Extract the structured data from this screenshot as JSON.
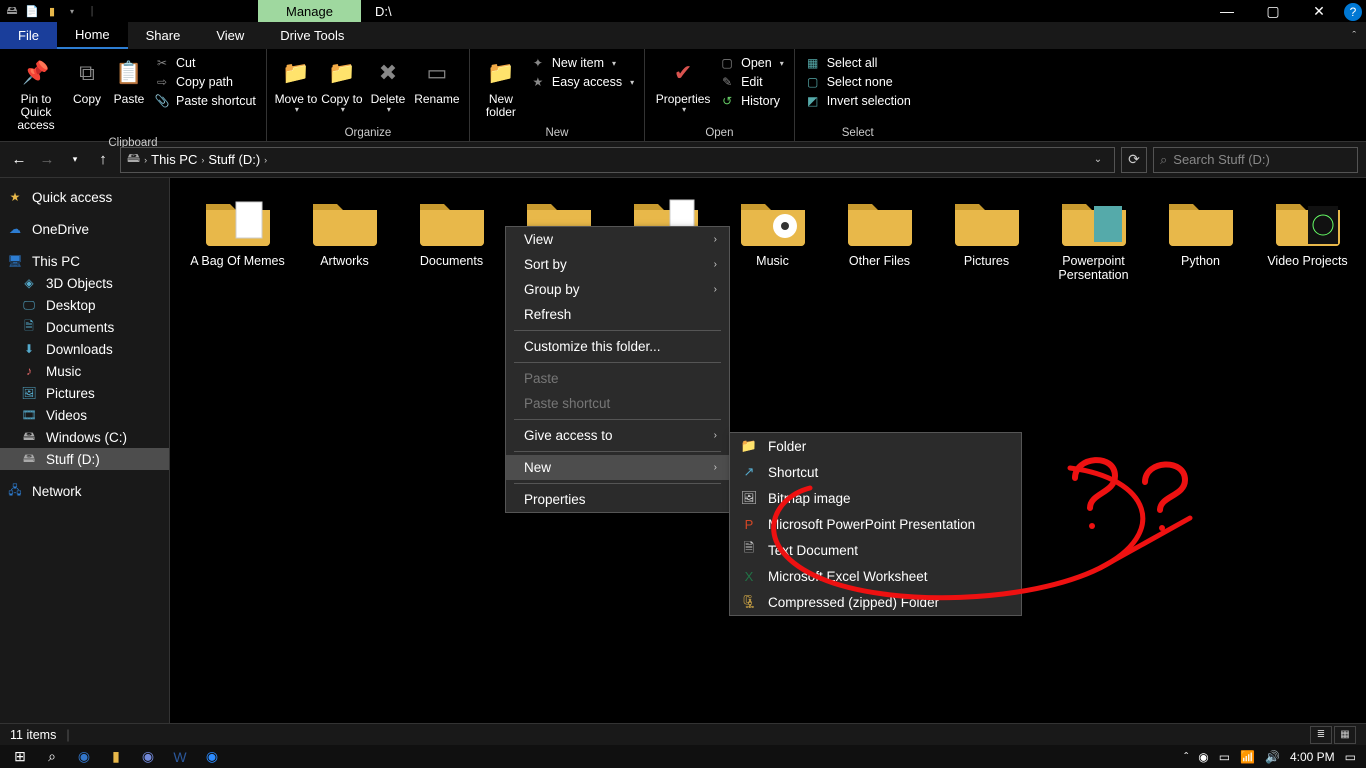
{
  "title": {
    "manage": "Manage",
    "path": "D:\\"
  },
  "window_controls": {
    "min": "—",
    "max": "▢",
    "close": "✕",
    "help": "?"
  },
  "tabs": {
    "file": "File",
    "home": "Home",
    "share": "Share",
    "view": "View",
    "drivetools": "Drive Tools"
  },
  "ribbon": {
    "clipboard": {
      "label": "Clipboard",
      "pin": "Pin to Quick access",
      "copy": "Copy",
      "paste": "Paste",
      "cut": "Cut",
      "copypath": "Copy path",
      "pasteshortcut": "Paste shortcut"
    },
    "organize": {
      "label": "Organize",
      "moveto": "Move to",
      "copyto": "Copy to",
      "delete": "Delete",
      "rename": "Rename"
    },
    "new": {
      "label": "New",
      "newfolder": "New folder",
      "newitem": "New item",
      "easyaccess": "Easy access"
    },
    "open": {
      "label": "Open",
      "properties": "Properties",
      "open": "Open",
      "edit": "Edit",
      "history": "History"
    },
    "select": {
      "label": "Select",
      "selectall": "Select all",
      "selectnone": "Select none",
      "invert": "Invert selection"
    }
  },
  "breadcrumb": {
    "thispc": "This PC",
    "drive": "Stuff (D:)"
  },
  "search": {
    "placeholder": "Search Stuff (D:)"
  },
  "navpane": {
    "quickaccess": "Quick access",
    "onedrive": "OneDrive",
    "thispc": "This PC",
    "objects3d": "3D Objects",
    "desktop": "Desktop",
    "documents": "Documents",
    "downloads": "Downloads",
    "music": "Music",
    "pictures": "Pictures",
    "videos": "Videos",
    "windowsc": "Windows (C:)",
    "stuffd": "Stuff (D:)",
    "network": "Network"
  },
  "folders": [
    "A Bag Of Memes",
    "Artworks",
    "Documents",
    "",
    "",
    "Music",
    "Other Files",
    "Pictures",
    "Powerpoint Persentation",
    "Python",
    "Video Projects"
  ],
  "context_menu": {
    "view": "View",
    "sortby": "Sort by",
    "groupby": "Group by",
    "refresh": "Refresh",
    "customize": "Customize this folder...",
    "paste": "Paste",
    "pasteshortcut": "Paste shortcut",
    "giveaccess": "Give access to",
    "new": "New",
    "properties": "Properties"
  },
  "new_submenu": {
    "folder": "Folder",
    "shortcut": "Shortcut",
    "bitmap": "Bitmap image",
    "ppt": "Microsoft PowerPoint Presentation",
    "txt": "Text Document",
    "xls": "Microsoft Excel Worksheet",
    "zip": "Compressed (zipped) Folder"
  },
  "status": {
    "count": "11 items"
  },
  "taskbar": {
    "time": "4:00 PM"
  }
}
